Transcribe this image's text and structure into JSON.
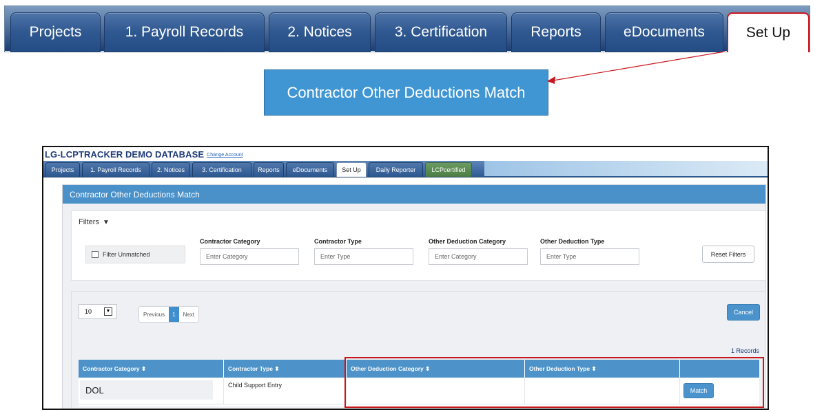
{
  "top_tabs": [
    {
      "label": "Projects"
    },
    {
      "label": "1. Payroll Records"
    },
    {
      "label": "2. Notices"
    },
    {
      "label": "3. Certification"
    },
    {
      "label": "Reports"
    },
    {
      "label": "eDocuments"
    },
    {
      "label": "Set Up"
    }
  ],
  "callout": {
    "label": "Contractor Other Deductions Match"
  },
  "app": {
    "db_title": "LG-LCPTRACKER DEMO DATABASE",
    "change_account": "Change Account",
    "tabs": [
      {
        "label": "Projects"
      },
      {
        "label": "1. Payroll Records"
      },
      {
        "label": "2. Notices"
      },
      {
        "label": "3. Certification"
      },
      {
        "label": "Reports"
      },
      {
        "label": "eDocuments"
      },
      {
        "label": "Set Up"
      },
      {
        "label": "Daily Reporter"
      },
      {
        "label": "LCPcertified"
      }
    ],
    "panel_title": "Contractor Other Deductions Match",
    "filters": {
      "title": "Filters",
      "filter_unmatched": "Filter Unmatched",
      "contractor_category_label": "Contractor Category",
      "contractor_category_placeholder": "Enter Category",
      "contractor_type_label": "Contractor Type",
      "contractor_type_placeholder": "Enter Type",
      "other_deduction_category_label": "Other Deduction Category",
      "other_deduction_category_placeholder": "Enter Category",
      "other_deduction_type_label": "Other Deduction Type",
      "other_deduction_type_placeholder": "Enter Type",
      "reset": "Reset Filters"
    },
    "list": {
      "page_size": "10",
      "previous": "Previous",
      "current_page": "1",
      "next": "Next",
      "cancel": "Cancel",
      "records": "1 Records",
      "columns": [
        "Contractor Category ⬍",
        "Contractor Type ⬍",
        "Other Deduction Category ⬍",
        "Other Deduction Type ⬍",
        ""
      ],
      "rows": [
        {
          "contractor_category": "DOL",
          "contractor_type": "Child Support Entry",
          "other_deduction_category": "",
          "other_deduction_type": "",
          "action": "Match"
        }
      ]
    }
  },
  "colors": {
    "accent_blue": "#4a93cc",
    "tab_dark": "#254d85",
    "highlight_red": "#c8161d"
  }
}
